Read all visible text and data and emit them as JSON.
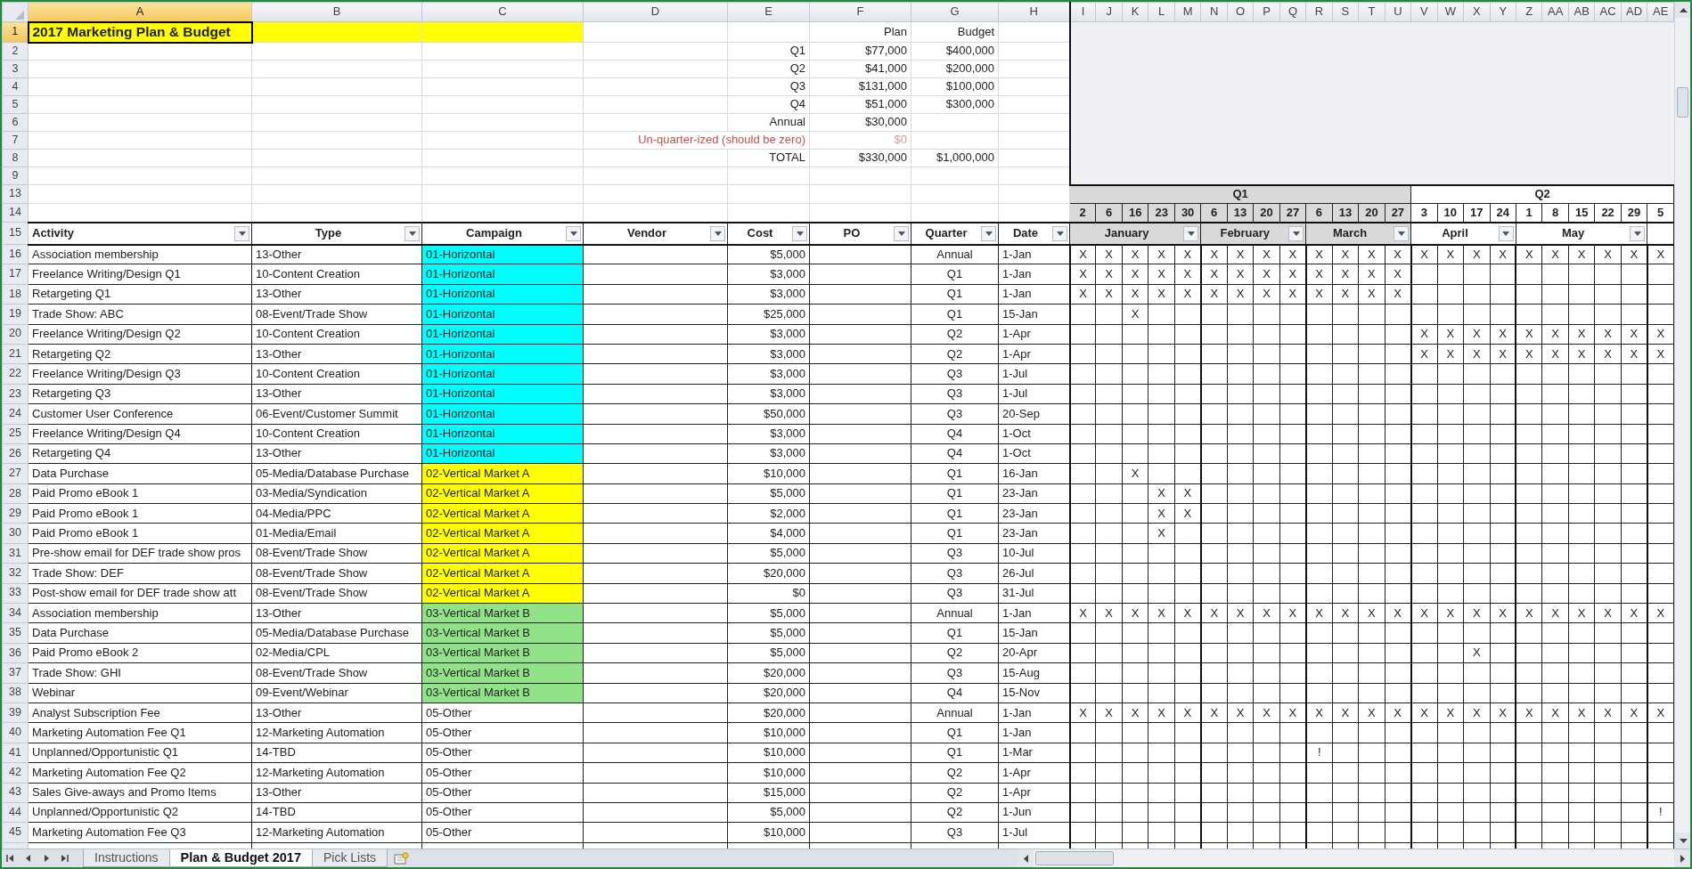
{
  "title": {
    "text": "2017 Marketing Plan & Budget",
    "selected": true
  },
  "column_headers": [
    {
      "label": "A",
      "selected": true
    },
    {
      "label": "B",
      "selected": false
    },
    {
      "label": "C",
      "selected": false
    },
    {
      "label": "D",
      "selected": false
    },
    {
      "label": "E",
      "selected": false
    },
    {
      "label": "F",
      "selected": false
    },
    {
      "label": "G",
      "selected": false
    },
    {
      "label": "H",
      "selected": false
    },
    {
      "label": "I",
      "selected": false
    },
    {
      "label": "J",
      "selected": false
    },
    {
      "label": "K",
      "selected": false
    },
    {
      "label": "L",
      "selected": false
    },
    {
      "label": "M",
      "selected": false
    },
    {
      "label": "N",
      "selected": false
    },
    {
      "label": "O",
      "selected": false
    },
    {
      "label": "P",
      "selected": false
    },
    {
      "label": "Q",
      "selected": false
    },
    {
      "label": "R",
      "selected": false
    },
    {
      "label": "S",
      "selected": false
    },
    {
      "label": "T",
      "selected": false
    },
    {
      "label": "U",
      "selected": false
    },
    {
      "label": "V",
      "selected": false
    },
    {
      "label": "W",
      "selected": false
    },
    {
      "label": "X",
      "selected": false
    },
    {
      "label": "Y",
      "selected": false
    },
    {
      "label": "Z",
      "selected": false
    },
    {
      "label": "AA",
      "selected": false
    },
    {
      "label": "AB",
      "selected": false
    },
    {
      "label": "AC",
      "selected": false
    },
    {
      "label": "AD",
      "selected": false
    },
    {
      "label": "AE",
      "selected": false
    }
  ],
  "row_headers": [
    {
      "label": "1",
      "selected": true
    },
    {
      "label": "2",
      "selected": false
    },
    {
      "label": "3",
      "selected": false
    },
    {
      "label": "4",
      "selected": false
    },
    {
      "label": "5",
      "selected": false
    },
    {
      "label": "6",
      "selected": false
    },
    {
      "label": "7",
      "selected": false
    },
    {
      "label": "8",
      "selected": false
    },
    {
      "label": "9",
      "selected": false
    },
    {
      "label": "13",
      "selected": false
    },
    {
      "label": "14",
      "selected": false
    },
    {
      "label": "15",
      "selected": false
    },
    {
      "label": "16",
      "selected": false
    },
    {
      "label": "17",
      "selected": false
    },
    {
      "label": "18",
      "selected": false
    },
    {
      "label": "19",
      "selected": false
    },
    {
      "label": "20",
      "selected": false
    },
    {
      "label": "21",
      "selected": false
    },
    {
      "label": "22",
      "selected": false
    },
    {
      "label": "23",
      "selected": false
    },
    {
      "label": "24",
      "selected": false
    },
    {
      "label": "25",
      "selected": false
    },
    {
      "label": "26",
      "selected": false
    },
    {
      "label": "27",
      "selected": false
    },
    {
      "label": "28",
      "selected": false
    },
    {
      "label": "29",
      "selected": false
    },
    {
      "label": "30",
      "selected": false
    },
    {
      "label": "31",
      "selected": false
    },
    {
      "label": "32",
      "selected": false
    },
    {
      "label": "33",
      "selected": false
    },
    {
      "label": "34",
      "selected": false
    },
    {
      "label": "35",
      "selected": false
    },
    {
      "label": "36",
      "selected": false
    },
    {
      "label": "37",
      "selected": false
    },
    {
      "label": "38",
      "selected": false
    },
    {
      "label": "39",
      "selected": false
    },
    {
      "label": "40",
      "selected": false
    },
    {
      "label": "41",
      "selected": false
    },
    {
      "label": "42",
      "selected": false
    },
    {
      "label": "43",
      "selected": false
    },
    {
      "label": "44",
      "selected": false
    },
    {
      "label": "45",
      "selected": false
    }
  ],
  "summary": {
    "headings": [
      "Plan",
      "Budget"
    ],
    "rows": [
      {
        "label": "Q1",
        "plan": "$77,000",
        "budget": "$400,000",
        "kind": "normal"
      },
      {
        "label": "Q2",
        "plan": "$41,000",
        "budget": "$200,000",
        "kind": "normal"
      },
      {
        "label": "Q3",
        "plan": "$131,000",
        "budget": "$100,000",
        "kind": "normal"
      },
      {
        "label": "Q4",
        "plan": "$51,000",
        "budget": "$300,000",
        "kind": "normal"
      },
      {
        "label": "Annual",
        "plan": "$30,000",
        "kind": "normal"
      },
      {
        "label": "Un-quarter-ized (should be zero)",
        "plan": "$0",
        "kind": "warning"
      },
      {
        "label": "TOTAL",
        "plan": "$330,000",
        "budget": "$1,000,000",
        "kind": "normal"
      }
    ]
  },
  "timeline": {
    "quarters": [
      {
        "label": "Q1",
        "shaded": true,
        "months": [
          {
            "label": "January",
            "weeks": [
              "2",
              "6",
              "16",
              "23",
              "30"
            ]
          },
          {
            "label": "February",
            "weeks": [
              "6",
              "13",
              "20",
              "27"
            ]
          },
          {
            "label": "March",
            "weeks": [
              "6",
              "13",
              "20",
              "27"
            ]
          }
        ]
      },
      {
        "label": "Q2",
        "shaded": false,
        "months": [
          {
            "label": "April",
            "weeks": [
              "3",
              "10",
              "17",
              "24"
            ]
          },
          {
            "label": "May",
            "weeks": [
              "1",
              "8",
              "15",
              "22",
              "29"
            ]
          },
          {
            "weeks": [
              "5"
            ]
          }
        ]
      }
    ]
  },
  "table": {
    "columns": [
      "Activity",
      "Type",
      "Campaign",
      "Vendor",
      "Cost",
      "PO",
      "Quarter",
      "Date"
    ],
    "rows": [
      {
        "activity": "Association membership",
        "type": "13-Other",
        "campaign": {
          "text": "01-Horizontal",
          "color": "#00ffff"
        },
        "cost": "$5,000",
        "quarter": "Annual",
        "date": "1-Jan",
        "cells": [
          {
            "kind": "mark",
            "text": "X"
          },
          {
            "kind": "mark",
            "text": "X"
          },
          {
            "kind": "mark",
            "text": "X"
          },
          {
            "kind": "mark",
            "text": "X"
          },
          {
            "kind": "mark",
            "text": "X"
          },
          {
            "kind": "mark",
            "text": "X"
          },
          {
            "kind": "mark",
            "text": "X"
          },
          {
            "kind": "mark",
            "text": "X"
          },
          {
            "kind": "mark",
            "text": "X"
          },
          {
            "kind": "mark",
            "text": "X"
          },
          {
            "kind": "mark",
            "text": "X"
          },
          {
            "kind": "mark",
            "text": "X"
          },
          {
            "kind": "mark",
            "text": "X"
          },
          {
            "kind": "mark",
            "text": "X"
          },
          {
            "kind": "mark",
            "text": "X"
          },
          {
            "kind": "mark",
            "text": "X"
          },
          {
            "kind": "mark",
            "text": "X"
          },
          {
            "kind": "mark",
            "text": "X"
          },
          {
            "kind": "mark",
            "text": "X"
          },
          {
            "kind": "mark",
            "text": "X"
          },
          {
            "kind": "mark",
            "text": "X"
          },
          {
            "kind": "mark",
            "text": "X"
          },
          {
            "kind": "mark",
            "text": "X"
          }
        ]
      },
      {
        "activity": "Freelance Writing/Design Q1",
        "type": "10-Content Creation",
        "campaign": {
          "text": "01-Horizontal",
          "color": "#00ffff"
        },
        "cost": "$3,000",
        "quarter": "Q1",
        "date": "1-Jan",
        "cells": [
          {
            "kind": "mark",
            "text": "X"
          },
          {
            "kind": "mark",
            "text": "X"
          },
          {
            "kind": "mark",
            "text": "X"
          },
          {
            "kind": "mark",
            "text": "X"
          },
          {
            "kind": "mark",
            "text": "X"
          },
          {
            "kind": "mark",
            "text": "X"
          },
          {
            "kind": "mark",
            "text": "X"
          },
          {
            "kind": "mark",
            "text": "X"
          },
          {
            "kind": "mark",
            "text": "X"
          },
          {
            "kind": "mark",
            "text": "X"
          },
          {
            "kind": "mark",
            "text": "X"
          },
          {
            "kind": "mark",
            "text": "X"
          },
          {
            "kind": "mark",
            "text": "X"
          },
          {
            "kind": "blank"
          },
          {
            "kind": "blank"
          },
          {
            "kind": "blank"
          },
          {
            "kind": "blank"
          },
          {
            "kind": "blank"
          },
          {
            "kind": "blank"
          },
          {
            "kind": "blank"
          },
          {
            "kind": "blank"
          },
          {
            "kind": "blank"
          },
          {
            "kind": "blank"
          }
        ]
      },
      {
        "activity": "Retargeting Q1",
        "type": "13-Other",
        "campaign": {
          "text": "01-Horizontal",
          "color": "#00ffff"
        },
        "cost": "$3,000",
        "quarter": "Q1",
        "date": "1-Jan",
        "cells": [
          {
            "kind": "mark",
            "text": "X"
          },
          {
            "kind": "mark",
            "text": "X"
          },
          {
            "kind": "mark",
            "text": "X"
          },
          {
            "kind": "mark",
            "text": "X"
          },
          {
            "kind": "mark",
            "text": "X"
          },
          {
            "kind": "mark",
            "text": "X"
          },
          {
            "kind": "mark",
            "text": "X"
          },
          {
            "kind": "mark",
            "text": "X"
          },
          {
            "kind": "mark",
            "text": "X"
          },
          {
            "kind": "mark",
            "text": "X"
          },
          {
            "kind": "mark",
            "text": "X"
          },
          {
            "kind": "mark",
            "text": "X"
          },
          {
            "kind": "mark",
            "text": "X"
          },
          {
            "kind": "blank"
          },
          {
            "kind": "blank"
          },
          {
            "kind": "blank"
          },
          {
            "kind": "blank"
          },
          {
            "kind": "blank"
          },
          {
            "kind": "blank"
          },
          {
            "kind": "blank"
          },
          {
            "kind": "blank"
          },
          {
            "kind": "blank"
          },
          {
            "kind": "blank"
          }
        ]
      },
      {
        "activity": "Trade Show: ABC",
        "type": "08-Event/Trade Show",
        "campaign": {
          "text": "01-Horizontal",
          "color": "#00ffff"
        },
        "cost": "$25,000",
        "quarter": "Q1",
        "date": "15-Jan",
        "cells": [
          {
            "kind": "blank"
          },
          {
            "kind": "blank"
          },
          {
            "kind": "mark",
            "text": "X"
          },
          {
            "kind": "blank"
          },
          {
            "kind": "blank"
          },
          {
            "kind": "blank"
          },
          {
            "kind": "blank"
          },
          {
            "kind": "blank"
          },
          {
            "kind": "blank"
          },
          {
            "kind": "blank"
          },
          {
            "kind": "blank"
          },
          {
            "kind": "blank"
          },
          {
            "kind": "blank"
          },
          {
            "kind": "blank"
          },
          {
            "kind": "blank"
          },
          {
            "kind": "blank"
          },
          {
            "kind": "blank"
          },
          {
            "kind": "blank"
          },
          {
            "kind": "blank"
          },
          {
            "kind": "blank"
          },
          {
            "kind": "blank"
          },
          {
            "kind": "blank"
          },
          {
            "kind": "blank"
          }
        ]
      },
      {
        "activity": "Freelance Writing/Design Q2",
        "type": "10-Content Creation",
        "campaign": {
          "text": "01-Horizontal",
          "color": "#00ffff"
        },
        "cost": "$3,000",
        "quarter": "Q2",
        "date": "1-Apr",
        "cells": [
          {
            "kind": "blank"
          },
          {
            "kind": "blank"
          },
          {
            "kind": "blank"
          },
          {
            "kind": "blank"
          },
          {
            "kind": "blank"
          },
          {
            "kind": "blank"
          },
          {
            "kind": "blank"
          },
          {
            "kind": "blank"
          },
          {
            "kind": "blank"
          },
          {
            "kind": "blank"
          },
          {
            "kind": "blank"
          },
          {
            "kind": "blank"
          },
          {
            "kind": "blank"
          },
          {
            "kind": "mark",
            "text": "X"
          },
          {
            "kind": "mark",
            "text": "X"
          },
          {
            "kind": "mark",
            "text": "X"
          },
          {
            "kind": "mark",
            "text": "X"
          },
          {
            "kind": "mark",
            "text": "X"
          },
          {
            "kind": "mark",
            "text": "X"
          },
          {
            "kind": "mark",
            "text": "X"
          },
          {
            "kind": "mark",
            "text": "X"
          },
          {
            "kind": "mark",
            "text": "X"
          },
          {
            "kind": "mark",
            "text": "X"
          }
        ]
      },
      {
        "activity": "Retargeting Q2",
        "type": "13-Other",
        "campaign": {
          "text": "01-Horizontal",
          "color": "#00ffff"
        },
        "cost": "$3,000",
        "quarter": "Q2",
        "date": "1-Apr",
        "cells": [
          {
            "kind": "blank"
          },
          {
            "kind": "blank"
          },
          {
            "kind": "blank"
          },
          {
            "kind": "blank"
          },
          {
            "kind": "blank"
          },
          {
            "kind": "blank"
          },
          {
            "kind": "blank"
          },
          {
            "kind": "blank"
          },
          {
            "kind": "blank"
          },
          {
            "kind": "blank"
          },
          {
            "kind": "blank"
          },
          {
            "kind": "blank"
          },
          {
            "kind": "blank"
          },
          {
            "kind": "mark",
            "text": "X"
          },
          {
            "kind": "mark",
            "text": "X"
          },
          {
            "kind": "mark",
            "text": "X"
          },
          {
            "kind": "mark",
            "text": "X"
          },
          {
            "kind": "mark",
            "text": "X"
          },
          {
            "kind": "mark",
            "text": "X"
          },
          {
            "kind": "mark",
            "text": "X"
          },
          {
            "kind": "mark",
            "text": "X"
          },
          {
            "kind": "mark",
            "text": "X"
          },
          {
            "kind": "mark",
            "text": "X"
          }
        ]
      },
      {
        "activity": "Freelance Writing/Design Q3",
        "type": "10-Content Creation",
        "campaign": {
          "text": "01-Horizontal",
          "color": "#00ffff"
        },
        "cost": "$3,000",
        "quarter": "Q3",
        "date": "1-Jul"
      },
      {
        "activity": "Retargeting Q3",
        "type": "13-Other",
        "campaign": {
          "text": "01-Horizontal",
          "color": "#00ffff"
        },
        "cost": "$3,000",
        "quarter": "Q3",
        "date": "1-Jul"
      },
      {
        "activity": "Customer User Conference",
        "type": "06-Event/Customer Summit",
        "campaign": {
          "text": "01-Horizontal",
          "color": "#00ffff"
        },
        "cost": "$50,000",
        "quarter": "Q3",
        "date": "20-Sep"
      },
      {
        "activity": "Freelance Writing/Design Q4",
        "type": "10-Content Creation",
        "campaign": {
          "text": "01-Horizontal",
          "color": "#00ffff"
        },
        "cost": "$3,000",
        "quarter": "Q4",
        "date": "1-Oct"
      },
      {
        "activity": "Retargeting Q4",
        "type": "13-Other",
        "campaign": {
          "text": "01-Horizontal",
          "color": "#00ffff"
        },
        "cost": "$3,000",
        "quarter": "Q4",
        "date": "1-Oct"
      },
      {
        "activity": "Data Purchase",
        "type": "05-Media/Database Purchase",
        "campaign": {
          "text": "02-Vertical Market A",
          "color": "#ffff00"
        },
        "cost": "$10,000",
        "quarter": "Q1",
        "date": "16-Jan",
        "cells": [
          {
            "kind": "blank"
          },
          {
            "kind": "blank"
          },
          {
            "kind": "mark",
            "text": "X"
          },
          {
            "kind": "blank"
          },
          {
            "kind": "blank"
          },
          {
            "kind": "blank"
          },
          {
            "kind": "blank"
          },
          {
            "kind": "blank"
          },
          {
            "kind": "blank"
          },
          {
            "kind": "blank"
          },
          {
            "kind": "blank"
          },
          {
            "kind": "blank"
          },
          {
            "kind": "blank"
          },
          {
            "kind": "blank"
          },
          {
            "kind": "blank"
          },
          {
            "kind": "blank"
          },
          {
            "kind": "blank"
          },
          {
            "kind": "blank"
          },
          {
            "kind": "blank"
          },
          {
            "kind": "blank"
          },
          {
            "kind": "blank"
          },
          {
            "kind": "blank"
          },
          {
            "kind": "blank"
          }
        ]
      },
      {
        "activity": "Paid Promo eBook 1",
        "type": "03-Media/Syndication",
        "campaign": {
          "text": "02-Vertical Market A",
          "color": "#ffff00"
        },
        "cost": "$5,000",
        "quarter": "Q1",
        "date": "23-Jan",
        "cells": [
          {
            "kind": "blank"
          },
          {
            "kind": "blank"
          },
          {
            "kind": "blank"
          },
          {
            "kind": "mark",
            "text": "X"
          },
          {
            "kind": "mark",
            "text": "X"
          },
          {
            "kind": "blank"
          },
          {
            "kind": "blank"
          },
          {
            "kind": "blank"
          },
          {
            "kind": "blank"
          },
          {
            "kind": "blank"
          },
          {
            "kind": "blank"
          },
          {
            "kind": "blank"
          },
          {
            "kind": "blank"
          },
          {
            "kind": "blank"
          },
          {
            "kind": "blank"
          },
          {
            "kind": "blank"
          },
          {
            "kind": "blank"
          },
          {
            "kind": "blank"
          },
          {
            "kind": "blank"
          },
          {
            "kind": "blank"
          },
          {
            "kind": "blank"
          },
          {
            "kind": "blank"
          },
          {
            "kind": "blank"
          }
        ]
      },
      {
        "activity": "Paid Promo eBook 1",
        "type": "04-Media/PPC",
        "campaign": {
          "text": "02-Vertical Market A",
          "color": "#ffff00"
        },
        "cost": "$2,000",
        "quarter": "Q1",
        "date": "23-Jan",
        "cells": [
          {
            "kind": "blank"
          },
          {
            "kind": "blank"
          },
          {
            "kind": "blank"
          },
          {
            "kind": "mark",
            "text": "X"
          },
          {
            "kind": "mark",
            "text": "X"
          },
          {
            "kind": "blank"
          },
          {
            "kind": "blank"
          },
          {
            "kind": "blank"
          },
          {
            "kind": "blank"
          },
          {
            "kind": "blank"
          },
          {
            "kind": "blank"
          },
          {
            "kind": "blank"
          },
          {
            "kind": "blank"
          },
          {
            "kind": "blank"
          },
          {
            "kind": "blank"
          },
          {
            "kind": "blank"
          },
          {
            "kind": "blank"
          },
          {
            "kind": "blank"
          },
          {
            "kind": "blank"
          },
          {
            "kind": "blank"
          },
          {
            "kind": "blank"
          },
          {
            "kind": "blank"
          },
          {
            "kind": "blank"
          }
        ]
      },
      {
        "activity": "Paid Promo eBook 1",
        "type": "01-Media/Email",
        "campaign": {
          "text": "02-Vertical Market A",
          "color": "#ffff00"
        },
        "cost": "$4,000",
        "quarter": "Q1",
        "date": "23-Jan",
        "cells": [
          {
            "kind": "blank"
          },
          {
            "kind": "blank"
          },
          {
            "kind": "blank"
          },
          {
            "kind": "mark",
            "text": "X"
          },
          {
            "kind": "blank"
          },
          {
            "kind": "blank"
          },
          {
            "kind": "blank"
          },
          {
            "kind": "blank"
          },
          {
            "kind": "blank"
          },
          {
            "kind": "blank"
          },
          {
            "kind": "blank"
          },
          {
            "kind": "blank"
          },
          {
            "kind": "blank"
          },
          {
            "kind": "blank"
          },
          {
            "kind": "blank"
          },
          {
            "kind": "blank"
          },
          {
            "kind": "blank"
          },
          {
            "kind": "blank"
          },
          {
            "kind": "blank"
          },
          {
            "kind": "blank"
          },
          {
            "kind": "blank"
          },
          {
            "kind": "blank"
          },
          {
            "kind": "blank"
          }
        ]
      },
      {
        "activity": "Pre-show email for DEF trade show pros",
        "type": "08-Event/Trade Show",
        "campaign": {
          "text": "02-Vertical Market A",
          "color": "#ffff00"
        },
        "cost": "$5,000",
        "quarter": "Q3",
        "date": "10-Jul"
      },
      {
        "activity": "Trade Show: DEF",
        "type": "08-Event/Trade Show",
        "campaign": {
          "text": "02-Vertical Market A",
          "color": "#ffff00"
        },
        "cost": "$20,000",
        "quarter": "Q3",
        "date": "26-Jul"
      },
      {
        "activity": "Post-show email for DEF trade show att",
        "type": "08-Event/Trade Show",
        "campaign": {
          "text": "02-Vertical Market A",
          "color": "#ffff00"
        },
        "cost": "$0",
        "quarter": "Q3",
        "date": "31-Jul"
      },
      {
        "activity": "Association membership",
        "type": "13-Other",
        "campaign": {
          "text": "03-Vertical Market B",
          "color": "#92e28a"
        },
        "cost": "$5,000",
        "quarter": "Annual",
        "date": "1-Jan",
        "cells": [
          {
            "kind": "mark",
            "text": "X"
          },
          {
            "kind": "mark",
            "text": "X"
          },
          {
            "kind": "mark",
            "text": "X"
          },
          {
            "kind": "mark",
            "text": "X"
          },
          {
            "kind": "mark",
            "text": "X"
          },
          {
            "kind": "mark",
            "text": "X"
          },
          {
            "kind": "mark",
            "text": "X"
          },
          {
            "kind": "mark",
            "text": "X"
          },
          {
            "kind": "mark",
            "text": "X"
          },
          {
            "kind": "mark",
            "text": "X"
          },
          {
            "kind": "mark",
            "text": "X"
          },
          {
            "kind": "mark",
            "text": "X"
          },
          {
            "kind": "mark",
            "text": "X"
          },
          {
            "kind": "mark",
            "text": "X"
          },
          {
            "kind": "mark",
            "text": "X"
          },
          {
            "kind": "mark",
            "text": "X"
          },
          {
            "kind": "mark",
            "text": "X"
          },
          {
            "kind": "mark",
            "text": "X"
          },
          {
            "kind": "mark",
            "text": "X"
          },
          {
            "kind": "mark",
            "text": "X"
          },
          {
            "kind": "mark",
            "text": "X"
          },
          {
            "kind": "mark",
            "text": "X"
          },
          {
            "kind": "mark",
            "text": "X"
          }
        ]
      },
      {
        "activity": "Data Purchase",
        "type": "05-Media/Database Purchase",
        "campaign": {
          "text": "03-Vertical Market B",
          "color": "#92e28a"
        },
        "cost": "$5,000",
        "quarter": "Q1",
        "date": "15-Jan"
      },
      {
        "activity": "Paid Promo eBook 2",
        "type": "02-Media/CPL",
        "campaign": {
          "text": "03-Vertical Market B",
          "color": "#92e28a"
        },
        "cost": "$5,000",
        "quarter": "Q2",
        "date": "20-Apr",
        "cells": [
          {
            "kind": "blank"
          },
          {
            "kind": "blank"
          },
          {
            "kind": "blank"
          },
          {
            "kind": "blank"
          },
          {
            "kind": "blank"
          },
          {
            "kind": "blank"
          },
          {
            "kind": "blank"
          },
          {
            "kind": "blank"
          },
          {
            "kind": "blank"
          },
          {
            "kind": "blank"
          },
          {
            "kind": "blank"
          },
          {
            "kind": "blank"
          },
          {
            "kind": "blank"
          },
          {
            "kind": "blank"
          },
          {
            "kind": "blank"
          },
          {
            "kind": "mark",
            "text": "X"
          },
          {
            "kind": "blank"
          },
          {
            "kind": "blank"
          },
          {
            "kind": "blank"
          },
          {
            "kind": "blank"
          },
          {
            "kind": "blank"
          },
          {
            "kind": "blank"
          },
          {
            "kind": "blank"
          }
        ]
      },
      {
        "activity": "Trade Show: GHI",
        "type": "08-Event/Trade Show",
        "campaign": {
          "text": "03-Vertical Market B",
          "color": "#92e28a"
        },
        "cost": "$20,000",
        "quarter": "Q3",
        "date": "15-Aug"
      },
      {
        "activity": "Webinar",
        "type": "09-Event/Webinar",
        "campaign": {
          "text": "03-Vertical Market B",
          "color": "#92e28a"
        },
        "cost": "$20,000",
        "quarter": "Q4",
        "date": "15-Nov"
      },
      {
        "activity": "Analyst Subscription Fee",
        "type": "13-Other",
        "campaign": {
          "text": "05-Other"
        },
        "cost": "$20,000",
        "quarter": "Annual",
        "date": "1-Jan",
        "cells": [
          {
            "kind": "mark",
            "text": "X"
          },
          {
            "kind": "mark",
            "text": "X"
          },
          {
            "kind": "mark",
            "text": "X"
          },
          {
            "kind": "mark",
            "text": "X"
          },
          {
            "kind": "mark",
            "text": "X"
          },
          {
            "kind": "mark",
            "text": "X"
          },
          {
            "kind": "mark",
            "text": "X"
          },
          {
            "kind": "mark",
            "text": "X"
          },
          {
            "kind": "mark",
            "text": "X"
          },
          {
            "kind": "mark",
            "text": "X"
          },
          {
            "kind": "mark",
            "text": "X"
          },
          {
            "kind": "mark",
            "text": "X"
          },
          {
            "kind": "mark",
            "text": "X"
          },
          {
            "kind": "mark",
            "text": "X"
          },
          {
            "kind": "mark",
            "text": "X"
          },
          {
            "kind": "mark",
            "text": "X"
          },
          {
            "kind": "mark",
            "text": "X"
          },
          {
            "kind": "mark",
            "text": "X"
          },
          {
            "kind": "mark",
            "text": "X"
          },
          {
            "kind": "mark",
            "text": "X"
          },
          {
            "kind": "mark",
            "text": "X"
          },
          {
            "kind": "mark",
            "text": "X"
          },
          {
            "kind": "mark",
            "text": "X"
          }
        ]
      },
      {
        "activity": "Marketing Automation Fee Q1",
        "type": "12-Marketing Automation",
        "campaign": {
          "text": "05-Other"
        },
        "cost": "$10,000",
        "quarter": "Q1",
        "date": "1-Jan"
      },
      {
        "activity": "Unplanned/Opportunistic Q1",
        "type": "14-TBD",
        "campaign": {
          "text": "05-Other"
        },
        "cost": "$10,000",
        "quarter": "Q1",
        "date": "1-Mar",
        "cells": [
          {
            "kind": "blank"
          },
          {
            "kind": "blank"
          },
          {
            "kind": "blank"
          },
          {
            "kind": "blank"
          },
          {
            "kind": "blank"
          },
          {
            "kind": "blank"
          },
          {
            "kind": "blank"
          },
          {
            "kind": "blank"
          },
          {
            "kind": "blank"
          },
          {
            "kind": "mark",
            "text": "!"
          },
          {
            "kind": "blank"
          },
          {
            "kind": "blank"
          },
          {
            "kind": "blank"
          },
          {
            "kind": "blank"
          },
          {
            "kind": "blank"
          },
          {
            "kind": "blank"
          },
          {
            "kind": "blank"
          },
          {
            "kind": "blank"
          },
          {
            "kind": "blank"
          },
          {
            "kind": "blank"
          },
          {
            "kind": "blank"
          },
          {
            "kind": "blank"
          },
          {
            "kind": "blank"
          }
        ]
      },
      {
        "activity": "Marketing Automation Fee Q2",
        "type": "12-Marketing Automation",
        "campaign": {
          "text": "05-Other"
        },
        "cost": "$10,000",
        "quarter": "Q2",
        "date": "1-Apr"
      },
      {
        "activity": "Sales Give-aways and Promo Items",
        "type": "13-Other",
        "campaign": {
          "text": "05-Other"
        },
        "cost": "$15,000",
        "quarter": "Q2",
        "date": "1-Apr"
      },
      {
        "activity": "Unplanned/Opportunistic Q2",
        "type": "14-TBD",
        "campaign": {
          "text": "05-Other"
        },
        "cost": "$5,000",
        "quarter": "Q2",
        "date": "1-Jun",
        "cells": [
          {
            "kind": "blank"
          },
          {
            "kind": "blank"
          },
          {
            "kind": "blank"
          },
          {
            "kind": "blank"
          },
          {
            "kind": "blank"
          },
          {
            "kind": "blank"
          },
          {
            "kind": "blank"
          },
          {
            "kind": "blank"
          },
          {
            "kind": "blank"
          },
          {
            "kind": "blank"
          },
          {
            "kind": "blank"
          },
          {
            "kind": "blank"
          },
          {
            "kind": "blank"
          },
          {
            "kind": "blank"
          },
          {
            "kind": "blank"
          },
          {
            "kind": "blank"
          },
          {
            "kind": "blank"
          },
          {
            "kind": "blank"
          },
          {
            "kind": "blank"
          },
          {
            "kind": "blank"
          },
          {
            "kind": "blank"
          },
          {
            "kind": "blank"
          },
          {
            "kind": "mark",
            "text": "!"
          }
        ]
      },
      {
        "activity": "Marketing Automation Fee Q3",
        "type": "12-Marketing Automation",
        "campaign": {
          "text": "05-Other"
        },
        "cost": "$10,000",
        "quarter": "Q3",
        "date": "1-Jul"
      }
    ]
  },
  "sheet_tabs": [
    {
      "label": "Instructions",
      "selected": false
    },
    {
      "label": "Plan & Budget 2017",
      "selected": true
    },
    {
      "label": "Pick Lists",
      "selected": false
    }
  ]
}
